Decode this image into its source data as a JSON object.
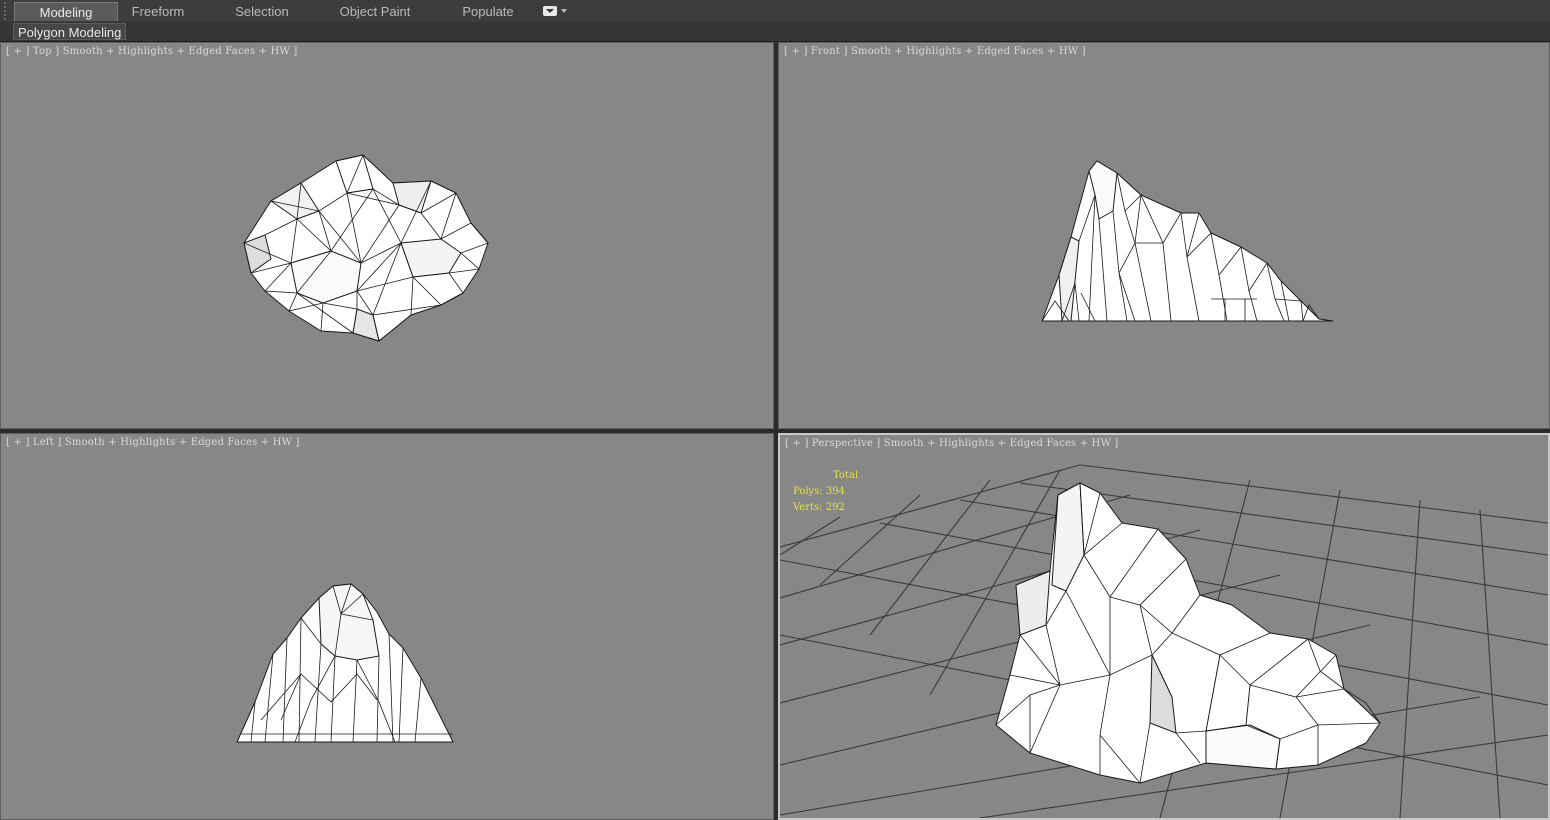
{
  "ribbon": {
    "tabs": [
      {
        "label": "Modeling",
        "active": true
      },
      {
        "label": "Freeform",
        "active": false
      },
      {
        "label": "Selection",
        "active": false
      },
      {
        "label": "Object Paint",
        "active": false
      },
      {
        "label": "Populate",
        "active": false
      }
    ],
    "options_icon": "dropdown-options-icon",
    "panel_label": "Polygon Modeling"
  },
  "viewports": {
    "top": {
      "label": "[ + ] Top ] Smooth + Highlights + Edged Faces + HW ]"
    },
    "front": {
      "label": "[ + ] Front ] Smooth + Highlights + Edged Faces + HW ]"
    },
    "left": {
      "label": "[ + ] Left ] Smooth + Highlights + Edged Faces + HW ]"
    },
    "perspective": {
      "label": "[ + ] Perspective ] Smooth + Highlights + Edged Faces + HW ]"
    }
  },
  "statistics": {
    "title": "Total",
    "polys": "Polys: 394",
    "verts": "Verts: 292"
  },
  "colors": {
    "viewport_bg": "#878787",
    "mesh_fill": "#ffffff",
    "wire": "#1a1a1a",
    "grid": "#3a3a3a",
    "stats": "#e8e14b"
  }
}
